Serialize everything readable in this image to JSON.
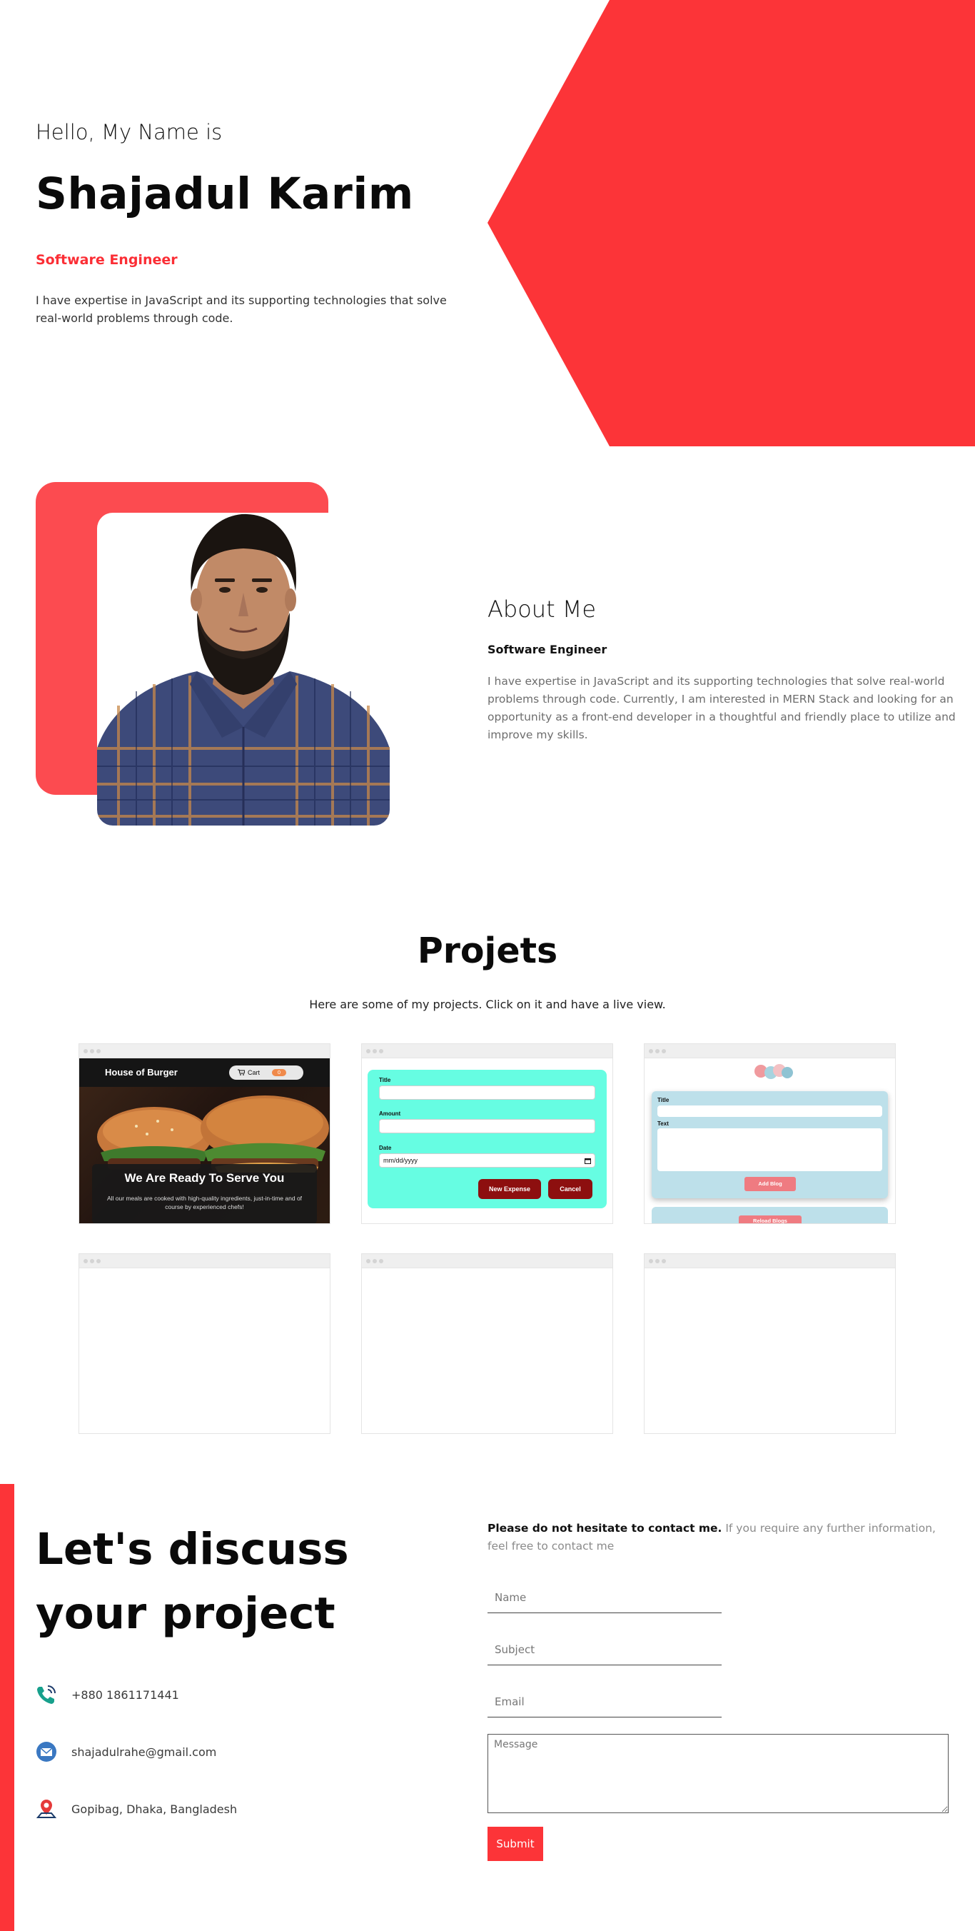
{
  "hero": {
    "greeting": "Hello, My Name is",
    "name": "Shajadul Karim",
    "role": "Software Engineer",
    "description": "I have expertise in JavaScript and its supporting technologies that solve real-world problems through code."
  },
  "about": {
    "title": "About Me",
    "role": "Software Engineer",
    "description": "I have expertise in JavaScript and its supporting technologies that solve real-world problems through code. Currently, I am interested in MERN Stack and looking for an opportunity as a front-end developer in a thoughtful and friendly place to utilize and improve my skills."
  },
  "projects": {
    "title": "Projets",
    "subtitle": "Here are some of my projects. Click on it and have a live view.",
    "burger": {
      "brand": "House of Burger",
      "cart_label": "Cart",
      "cart_count": "0",
      "headline": "We Are Ready To Serve You",
      "text": "All our meals are cooked with high-quality ingredients, just-in-time and of course by experienced chefs!"
    },
    "expense": {
      "title_label": "Title",
      "amount_label": "Amount",
      "date_label": "Date",
      "date_placeholder": "mm/dd/yyyy",
      "new_button": "New Expense",
      "cancel_button": "Cancel"
    },
    "blog": {
      "title_label": "Title",
      "text_label": "Text",
      "add_button": "Add Blog",
      "reload_button": "Reload Blogs"
    }
  },
  "contact": {
    "title_line1": "Let's discuss",
    "title_line2": "your project",
    "phone": "+880 1861171441",
    "email": "shajadulrahe@gmail.com",
    "address": "Gopibag, Dhaka, Bangladesh",
    "intro_bold": "Please do not hesitate to contact me.",
    "intro_rest": " If you require any further information, feel free to contact me",
    "name_placeholder": "Name",
    "subject_placeholder": "Subject",
    "email_placeholder": "Email",
    "message_placeholder": "Message",
    "submit_label": "Submit"
  },
  "colors": {
    "accent": "#fc3438",
    "about_frame": "#fc4b50",
    "expense_bg": "#66fde2",
    "blog_bg": "#bde0ea"
  },
  "icons": [
    "phone-icon",
    "email-icon",
    "location-pin-icon",
    "cart-icon",
    "calendar-icon"
  ]
}
